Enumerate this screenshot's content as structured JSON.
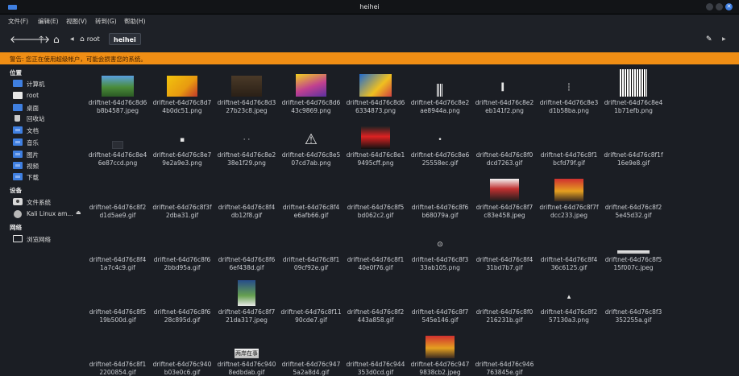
{
  "window": {
    "title": "heihei"
  },
  "menu": [
    "文件(F)",
    "编辑(E)",
    "视图(V)",
    "转到(G)",
    "帮助(H)"
  ],
  "path": {
    "root_label": "root",
    "current_label": "heihei"
  },
  "warning": "警告: 您正在使用超级帐户，可能会损害您的系统。",
  "sidebar": {
    "places_heading": "位置",
    "places": [
      "计算机",
      "root",
      "桌面",
      "回收站",
      "文档",
      "音乐",
      "图片",
      "视频",
      "下载"
    ],
    "devices_heading": "设备",
    "devices": [
      "文件系统",
      "Kali Linux am..."
    ],
    "network_heading": "网络",
    "network": [
      "浏览网络"
    ]
  },
  "files": [
    {
      "l1": "driftnet-64d76c8d6",
      "l2": "b8b4587.jpeg",
      "thumb": "photo-a"
    },
    {
      "l1": "driftnet-64d76c8d7",
      "l2": "4b0dc51.png",
      "thumb": "yellow"
    },
    {
      "l1": "driftnet-64d76c8d3",
      "l2": "27b23c8.jpeg",
      "thumb": "dark"
    },
    {
      "l1": "driftnet-64d76c8d6",
      "l2": "43c9869.png",
      "thumb": "poster"
    },
    {
      "l1": "driftnet-64d76c8d6",
      "l2": "6334873.png",
      "thumb": "blue"
    },
    {
      "l1": "driftnet-64d76c8e2",
      "l2": "ae8944a.png",
      "thumb": "barcode-strip"
    },
    {
      "l1": "driftnet-64d76c8e2",
      "l2": "eb141f2.png",
      "thumb": "tiny-mark"
    },
    {
      "l1": "driftnet-64d76c8e3",
      "l2": "d1b58ba.png",
      "thumb": "thin-line"
    },
    {
      "l1": "driftnet-64d76c8e4",
      "l2": "1b71efb.png",
      "thumb": "qr-code"
    },
    {
      "l1": "driftnet-64d76c8e4",
      "l2": "6e87ccd.png",
      "thumb": "dark-rect"
    },
    {
      "l1": "driftnet-64d76c8e7",
      "l2": "9e2a9e3.png",
      "thumb": "small-icon"
    },
    {
      "l1": "driftnet-64d76c8e2",
      "l2": "38e1f29.png",
      "thumb": "dots"
    },
    {
      "l1": "driftnet-64d76c8e5",
      "l2": "07cd7ab.png",
      "thumb": "warning-icon"
    },
    {
      "l1": "driftnet-64d76c8e1",
      "l2": "9495cff.png",
      "thumb": "meme"
    },
    {
      "l1": "driftnet-64d76c8e6",
      "l2": "25558ec.gif",
      "thumb": "small-dot"
    },
    {
      "l1": "driftnet-64d76c8f0",
      "l2": "dcd7263.gif",
      "thumb": "none"
    },
    {
      "l1": "driftnet-64d76c8f1",
      "l2": "bcfd79f.gif",
      "thumb": "none"
    },
    {
      "l1": "driftnet-64d76c8f1f",
      "l2": "16e9e8.gif",
      "thumb": "none"
    },
    {
      "l1": "driftnet-64d76c8f2",
      "l2": "d1d5ae9.gif",
      "thumb": "none"
    },
    {
      "l1": "driftnet-64d76c8f3f",
      "l2": "2dba31.gif",
      "thumb": "none"
    },
    {
      "l1": "driftnet-64d76c8f4",
      "l2": "db12f8.gif",
      "thumb": "none"
    },
    {
      "l1": "driftnet-64d76c8f4",
      "l2": "e6afb66.gif",
      "thumb": "none"
    },
    {
      "l1": "driftnet-64d76c8f5",
      "l2": "bd062c2.gif",
      "thumb": "none"
    },
    {
      "l1": "driftnet-64d76c8f6",
      "l2": "b68079a.gif",
      "thumb": "none"
    },
    {
      "l1": "driftnet-64d76c8f7",
      "l2": "c83e458.jpeg",
      "thumb": "news"
    },
    {
      "l1": "driftnet-64d76c8f7f",
      "l2": "dcc233.jpeg",
      "thumb": "crowd"
    },
    {
      "l1": "driftnet-64d76c8f2",
      "l2": "5e45d32.gif",
      "thumb": "none"
    },
    {
      "l1": "driftnet-64d76c8f4",
      "l2": "1a7c4c9.gif",
      "thumb": "none"
    },
    {
      "l1": "driftnet-64d76c8f6",
      "l2": "2bbd95a.gif",
      "thumb": "none"
    },
    {
      "l1": "driftnet-64d76c8f6",
      "l2": "6ef438d.gif",
      "thumb": "none"
    },
    {
      "l1": "driftnet-64d76c8f1",
      "l2": "09cf92e.gif",
      "thumb": "none"
    },
    {
      "l1": "driftnet-64d76c8f1",
      "l2": "40e0f76.gif",
      "thumb": "none"
    },
    {
      "l1": "driftnet-64d76c8f3",
      "l2": "33ab105.png",
      "thumb": "circle-icon"
    },
    {
      "l1": "driftnet-64d76c8f4",
      "l2": "31bd7b7.gif",
      "thumb": "none"
    },
    {
      "l1": "driftnet-64d76c8f4",
      "l2": "36c6125.gif",
      "thumb": "none"
    },
    {
      "l1": "driftnet-64d76c8f5",
      "l2": "15f007c.jpeg",
      "thumb": "banner-strip"
    },
    {
      "l1": "driftnet-64d76c8f5",
      "l2": "19b500d.gif",
      "thumb": "none"
    },
    {
      "l1": "driftnet-64d76c8f6",
      "l2": "28c895d.gif",
      "thumb": "none"
    },
    {
      "l1": "driftnet-64d76c8f7",
      "l2": "21da317.jpeg",
      "thumb": "cover"
    },
    {
      "l1": "driftnet-64d76c8f11",
      "l2": "90cde7.gif",
      "thumb": "none"
    },
    {
      "l1": "driftnet-64d76c8f2",
      "l2": "443a858.gif",
      "thumb": "none"
    },
    {
      "l1": "driftnet-64d76c8f7",
      "l2": "545e146.gif",
      "thumb": "none"
    },
    {
      "l1": "driftnet-64d76c8f0",
      "l2": "216231b.gif",
      "thumb": "none"
    },
    {
      "l1": "driftnet-64d76c8f2",
      "l2": "57130a3.png",
      "thumb": "tiny-sprite"
    },
    {
      "l1": "driftnet-64d76c8f3",
      "l2": "352255a.gif",
      "thumb": "none"
    },
    {
      "l1": "driftnet-64d76c8f1",
      "l2": "2200854.gif",
      "thumb": "none"
    },
    {
      "l1": "driftnet-64d76c940",
      "l2": "b03e0c6.gif",
      "thumb": "none"
    },
    {
      "l1": "driftnet-64d76c940",
      "l2": "8edbdab.gif",
      "thumb": "banner"
    },
    {
      "l1": "driftnet-64d76c947",
      "l2": "5a2a8d4.gif",
      "thumb": "none"
    },
    {
      "l1": "driftnet-64d76c944",
      "l2": "353d0cd.gif",
      "thumb": "none"
    },
    {
      "l1": "driftnet-64d76c947",
      "l2": "9838cb2.jpeg",
      "thumb": "crowd"
    },
    {
      "l1": "driftnet-64d76c946",
      "l2": "763845e.gif",
      "thumb": "none"
    }
  ],
  "thumb_texts": {
    "banner": "两岸在事"
  }
}
